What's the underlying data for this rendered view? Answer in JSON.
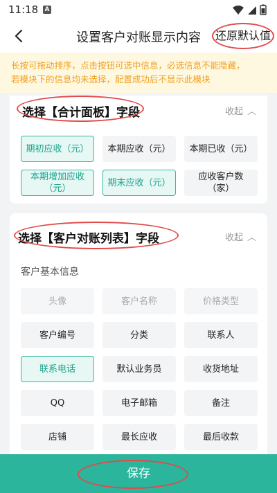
{
  "status_bar": {
    "time": "11:18",
    "badge": "A"
  },
  "nav": {
    "title": "设置客户对账显示内容",
    "restore_label": "还原默认值"
  },
  "notice": {
    "line1": "长按可拖动排序，点击按钮可选中信息，必选信息不能隐藏，",
    "line2": "若模块下的信息均未选择，配置成功后不显示此模块"
  },
  "section_summary": {
    "title": "选择【合计面板】字段",
    "collapse_label": "收起",
    "items": [
      {
        "label": "期初应收（元）",
        "selected": true
      },
      {
        "label": "本期应收（元）",
        "selected": false
      },
      {
        "label": "本期已收（元）",
        "selected": false
      },
      {
        "label": "本期增加应收\n（元）",
        "selected": true
      },
      {
        "label": "期末应收（元）",
        "selected": true
      },
      {
        "label": "应收客户数\n（家）",
        "selected": false
      }
    ]
  },
  "section_statement": {
    "title": "选择【客户对账列表】字段",
    "collapse_label": "收起",
    "group_label": "客户基本信息",
    "items": [
      {
        "label": "头像",
        "state": "disabled"
      },
      {
        "label": "客户名称",
        "state": "disabled"
      },
      {
        "label": "价格类型",
        "state": "disabled"
      },
      {
        "label": "客户编号",
        "state": "normal"
      },
      {
        "label": "分类",
        "state": "normal"
      },
      {
        "label": "联系人",
        "state": "normal"
      },
      {
        "label": "联系电话",
        "state": "selected"
      },
      {
        "label": "默认业务员",
        "state": "normal"
      },
      {
        "label": "收货地址",
        "state": "normal"
      },
      {
        "label": "QQ",
        "state": "normal"
      },
      {
        "label": "电子邮箱",
        "state": "normal"
      },
      {
        "label": "备注",
        "state": "normal"
      },
      {
        "label": "店铺",
        "state": "normal"
      },
      {
        "label": "最长应收",
        "state": "normal"
      },
      {
        "label": "最后收款",
        "state": "normal"
      }
    ]
  },
  "footer": {
    "save_label": "保存"
  },
  "colors": {
    "accent": "#2bb59c",
    "annotation": "#e24a4a",
    "notice_text": "#f0a020"
  }
}
